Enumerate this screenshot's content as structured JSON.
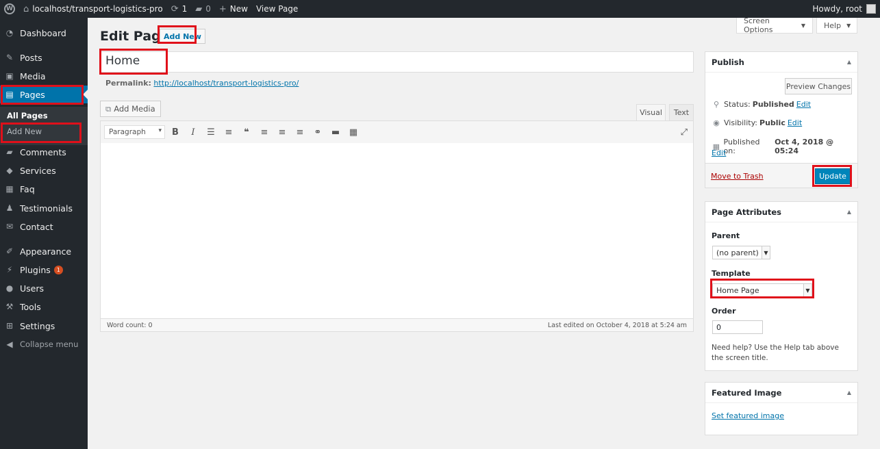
{
  "adminbar": {
    "site_name": "localhost/transport-logistics-pro",
    "updates_count": "1",
    "comments_count": "0",
    "new_label": "New",
    "view_page_label": "View Page",
    "howdy": "Howdy, root"
  },
  "sidebar": {
    "items": [
      {
        "label": "Dashboard",
        "icon": "dashboard-icon"
      },
      {
        "label": "Posts",
        "icon": "pin-icon"
      },
      {
        "label": "Media",
        "icon": "media-icon"
      },
      {
        "label": "Pages",
        "icon": "pages-icon"
      },
      {
        "label": "Comments",
        "icon": "comment-icon"
      },
      {
        "label": "Services",
        "icon": "tag-icon"
      },
      {
        "label": "Faq",
        "icon": "document-icon"
      },
      {
        "label": "Testimonials",
        "icon": "users-icon"
      },
      {
        "label": "Contact",
        "icon": "mail-icon"
      },
      {
        "label": "Appearance",
        "icon": "brush-icon"
      },
      {
        "label": "Plugins",
        "icon": "plug-icon",
        "badge": "1"
      },
      {
        "label": "Users",
        "icon": "user-icon"
      },
      {
        "label": "Tools",
        "icon": "wrench-icon"
      },
      {
        "label": "Settings",
        "icon": "settings-icon"
      }
    ],
    "submenu": {
      "all_pages": "All Pages",
      "add_new": "Add New"
    },
    "collapse_label": "Collapse menu"
  },
  "header": {
    "title": "Edit Page",
    "add_new": "Add New",
    "screen_options": "Screen Options",
    "help": "Help"
  },
  "editor": {
    "title_value": "Home",
    "permalink_label": "Permalink:",
    "permalink_url": "http://localhost/transport-logistics-pro/",
    "add_media": "Add Media",
    "tab_visual": "Visual",
    "tab_text": "Text",
    "format_select": "Paragraph",
    "toolbar_buttons": [
      "bold",
      "italic",
      "bulleted-list",
      "numbered-list",
      "blockquote",
      "align-left",
      "align-center",
      "align-right",
      "link",
      "read-more",
      "toolbar-toggle"
    ],
    "word_count": "Word count: 0",
    "last_edited": "Last edited on October 4, 2018 at 5:24 am"
  },
  "publish": {
    "title": "Publish",
    "preview_changes": "Preview Changes",
    "status_label": "Status:",
    "status_value": "Published",
    "visibility_label": "Visibility:",
    "visibility_value": "Public",
    "published_label": "Published on:",
    "published_value": "Oct 4, 2018 @ 05:24",
    "edit": "Edit",
    "move_to_trash": "Move to Trash",
    "update": "Update"
  },
  "page_attributes": {
    "title": "Page Attributes",
    "parent_label": "Parent",
    "parent_value": "(no parent)",
    "template_label": "Template",
    "template_value": "Home Page",
    "order_label": "Order",
    "order_value": "0",
    "help_text": "Need help? Use the Help tab above the screen title."
  },
  "featured_image": {
    "title": "Featured Image",
    "set_link": "Set featured image"
  },
  "colors": {
    "admin_dark": "#23282d",
    "accent_blue": "#0073aa",
    "primary_button": "#0085ba",
    "highlight_red": "#e0101a"
  }
}
